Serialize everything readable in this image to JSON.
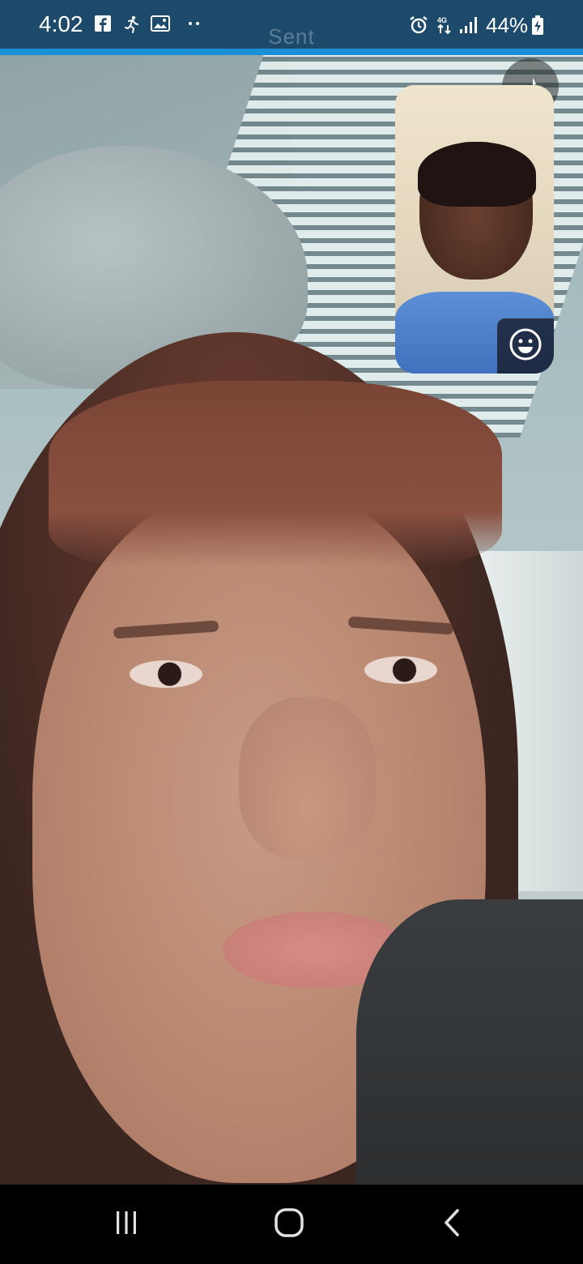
{
  "status_bar": {
    "time": "4:02",
    "battery": "44%",
    "notification_icons": [
      "facebook-icon",
      "running-icon",
      "gallery-icon",
      "more-dots-icon"
    ],
    "system_icons": [
      "alarm-icon",
      "4g-data-icon",
      "signal-icon",
      "battery-charging-icon"
    ],
    "overlay_label": "Sent",
    "colors": {
      "bar": "#1d4a6b",
      "accent": "#1a8fd6"
    }
  },
  "call": {
    "pip_controls": {
      "emoji_icon": "smiley-icon"
    },
    "camera_toggle_icon": "flip-camera-icon"
  },
  "nav_bar": {
    "buttons": [
      "recent-apps-icon",
      "home-icon",
      "back-icon"
    ]
  }
}
